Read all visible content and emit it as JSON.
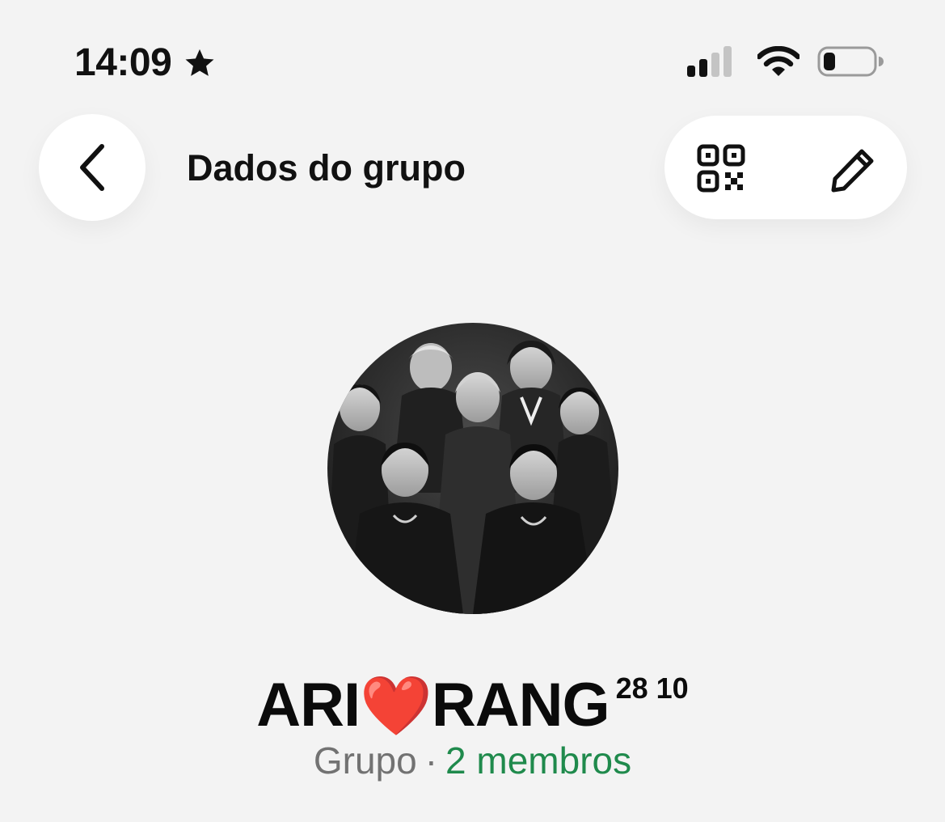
{
  "status_bar": {
    "time": "14:09",
    "icons": [
      "star-icon",
      "cellular-signal-icon",
      "wifi-icon",
      "battery-low-icon"
    ],
    "signal_bars_active": 2,
    "signal_bars_total": 4,
    "battery_level": 0.2
  },
  "header": {
    "title": "Dados do grupo",
    "icons": [
      "chevron-left-icon",
      "qr-code-icon",
      "pencil-icon"
    ]
  },
  "group": {
    "avatar_description_icon": "group-photo",
    "name_part1": "ARI",
    "name_heart": "❤️",
    "name_part2": "RANG",
    "name_superscript": "28 10",
    "kind": "Grupo",
    "separator": "·",
    "members": "2 membros"
  },
  "colors": {
    "background": "#f3f3f3",
    "surface": "#ffffff",
    "accent_green": "#1f8a4c",
    "secondary_text": "#727272",
    "heart_red": "#e0201f"
  }
}
